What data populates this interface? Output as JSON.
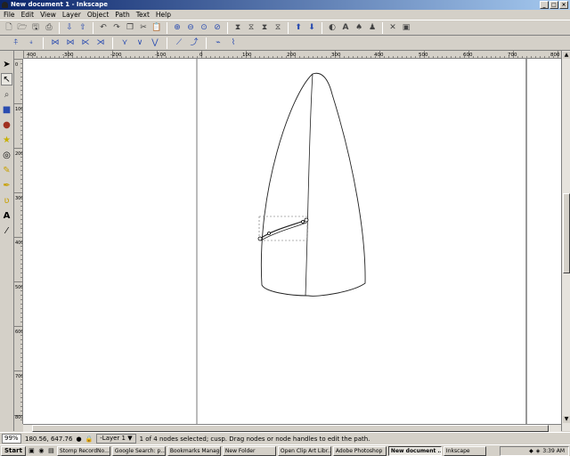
{
  "window": {
    "title": "New document 1 - Inkscape",
    "app_icon": "inkscape-icon"
  },
  "menu": [
    {
      "label": "File"
    },
    {
      "label": "Edit"
    },
    {
      "label": "View"
    },
    {
      "label": "Layer"
    },
    {
      "label": "Object"
    },
    {
      "label": "Path"
    },
    {
      "label": "Text"
    },
    {
      "label": "Help"
    }
  ],
  "toolbar_main_icons": [
    "new-icon",
    "open-icon",
    "save-icon",
    "print-icon",
    "import-icon",
    "export-icon",
    "undo-icon",
    "redo-icon",
    "copy-icon",
    "cut-icon",
    "paste-icon",
    "zoom-selection-icon",
    "zoom-drawing-icon",
    "zoom-page-icon",
    "duplicate-icon",
    "clone-icon",
    "unlink-clone-icon",
    "group-icon",
    "ungroup-icon",
    "fill-stroke-icon",
    "text-font-icon",
    "align-icon",
    "xml-editor-icon",
    "preferences-icon"
  ],
  "toolbar_node_icons": [
    "insert-node-icon",
    "delete-node-icon",
    "join-nodes-icon",
    "break-path-icon",
    "cusp-node-icon",
    "smooth-node-icon",
    "symmetric-node-icon",
    "make-line-icon",
    "make-curve-icon"
  ],
  "tools": [
    {
      "name": "selector-tool-icon",
      "glyph": "➤",
      "active": false
    },
    {
      "name": "node-tool-icon",
      "glyph": "↖",
      "active": true
    },
    {
      "name": "zoom-tool-icon",
      "glyph": "🔍",
      "active": false
    },
    {
      "name": "rect-tool-icon",
      "glyph": "■",
      "active": false
    },
    {
      "name": "ellipse-tool-icon",
      "glyph": "●",
      "active": false
    },
    {
      "name": "star-tool-icon",
      "glyph": "★",
      "active": false
    },
    {
      "name": "spiral-tool-icon",
      "glyph": "◎",
      "active": false
    },
    {
      "name": "pencil-tool-icon",
      "glyph": "✎",
      "active": false
    },
    {
      "name": "pen-tool-icon",
      "glyph": "✒",
      "active": false
    },
    {
      "name": "calligraphy-tool-icon",
      "glyph": "ʋ",
      "active": false
    },
    {
      "name": "text-tool-icon",
      "glyph": "A",
      "active": false
    },
    {
      "name": "dropper-tool-icon",
      "glyph": "⁄",
      "active": false
    }
  ],
  "ruler_h_labels": [
    "400",
    "-300",
    "-200",
    "-100",
    "0",
    "100",
    "200",
    "300",
    "400",
    "500",
    "600",
    "700",
    "800"
  ],
  "ruler_v_labels": [
    "0",
    "100",
    "200",
    "300",
    "400",
    "500",
    "600",
    "700",
    "800",
    "900"
  ],
  "status": {
    "zoom": "99%",
    "coords": "180.56, 647.76",
    "layer": "-Layer 1",
    "message": "1 of 4 nodes selected; cusp. Drag nodes or node handles to edit the path."
  },
  "taskbar": {
    "start_label": "Start",
    "buttons": [
      {
        "label": "Stomp RecordNo...",
        "active": false
      },
      {
        "label": "Google Search: p...",
        "active": false
      },
      {
        "label": "Bookmarks Manager",
        "active": false
      },
      {
        "label": "New Folder",
        "active": false
      },
      {
        "label": "Open Clip Art Libr...",
        "active": false
      },
      {
        "label": "Adobe Photoshop",
        "active": false
      },
      {
        "label": "New document ...",
        "active": true
      },
      {
        "label": "Inkscape",
        "active": false
      }
    ],
    "clock": "3:39 AM"
  }
}
